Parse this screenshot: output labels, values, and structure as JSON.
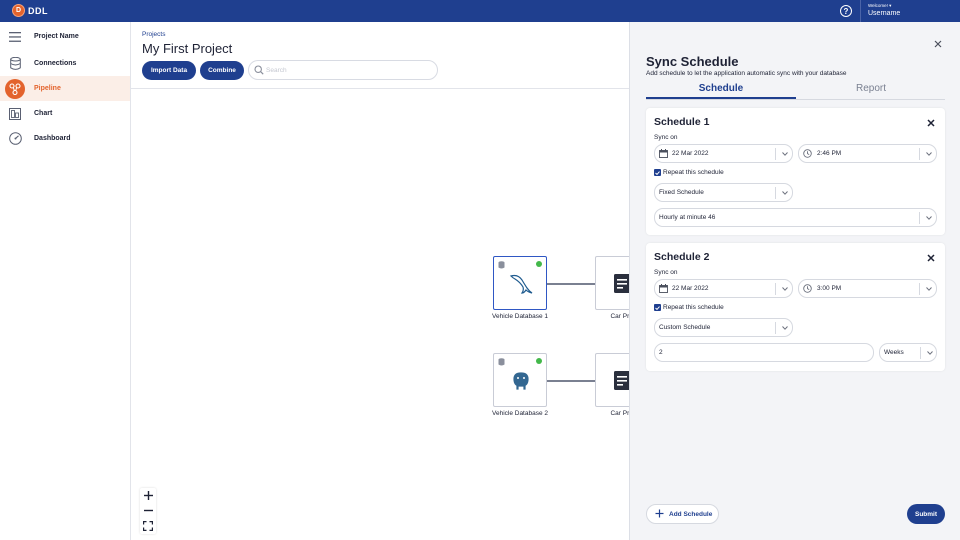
{
  "app": {
    "logo_text": "DDL",
    "welcome": "Welcome! ▾",
    "username": "Username",
    "help_icon": "question-circle-icon"
  },
  "sidebar": {
    "items": [
      {
        "label": "Project Name",
        "icon": "menu-icon"
      },
      {
        "label": "Connections",
        "icon": "database-icon"
      },
      {
        "label": "Pipeline",
        "icon": "pipeline-icon"
      },
      {
        "label": "Chart",
        "icon": "chart-icon"
      },
      {
        "label": "Dashboard",
        "icon": "dashboard-icon"
      }
    ],
    "active": "Pipeline",
    "accent": "#e3632d"
  },
  "header": {
    "breadcrumb": "Projects",
    "title": "My First Project",
    "import_label": "Import Data",
    "combine_label": "Combine",
    "search_placeholder": "Search",
    "search_value": ""
  },
  "canvas": {
    "nodes": [
      {
        "label": "Vehicle Database 1",
        "type": "mysql",
        "status": "connected"
      },
      {
        "label": "Car Price",
        "type": "document"
      },
      {
        "label": "Vehicle Database 2",
        "type": "postgresql",
        "status": "connected"
      },
      {
        "label": "Car Price",
        "type": "document"
      }
    ],
    "zoom_controls": [
      "zoom-in",
      "zoom-out",
      "fit-screen"
    ]
  },
  "panel": {
    "title": "Sync Schedule",
    "subtitle": "Add schedule to let the application automatic sync with your database",
    "tabs": [
      {
        "label": "Schedule",
        "active": true
      },
      {
        "label": "Report",
        "active": false
      }
    ],
    "schedules": [
      {
        "title": "Schedule 1",
        "sync_on_label": "Sync on",
        "date": "22 Mar 2022",
        "time": "2:46 PM",
        "repeat_label": "Repeat this schedule",
        "repeat_checked": true,
        "schedule_type": "Fixed Schedule",
        "frequency": "Hourly at minute 46"
      },
      {
        "title": "Schedule 2",
        "sync_on_label": "Sync on",
        "date": "22 Mar 2022",
        "time": "3:00 PM",
        "repeat_label": "Repeat this schedule",
        "repeat_checked": true,
        "schedule_type": "Custom Schedule",
        "interval_value": "2",
        "interval_unit": "Weeks"
      }
    ],
    "add_label": "Add Schedule",
    "submit_label": "Submit"
  },
  "colors": {
    "primary": "#1f3f8f",
    "accent": "#e3632d",
    "status_green": "#43b84a"
  }
}
